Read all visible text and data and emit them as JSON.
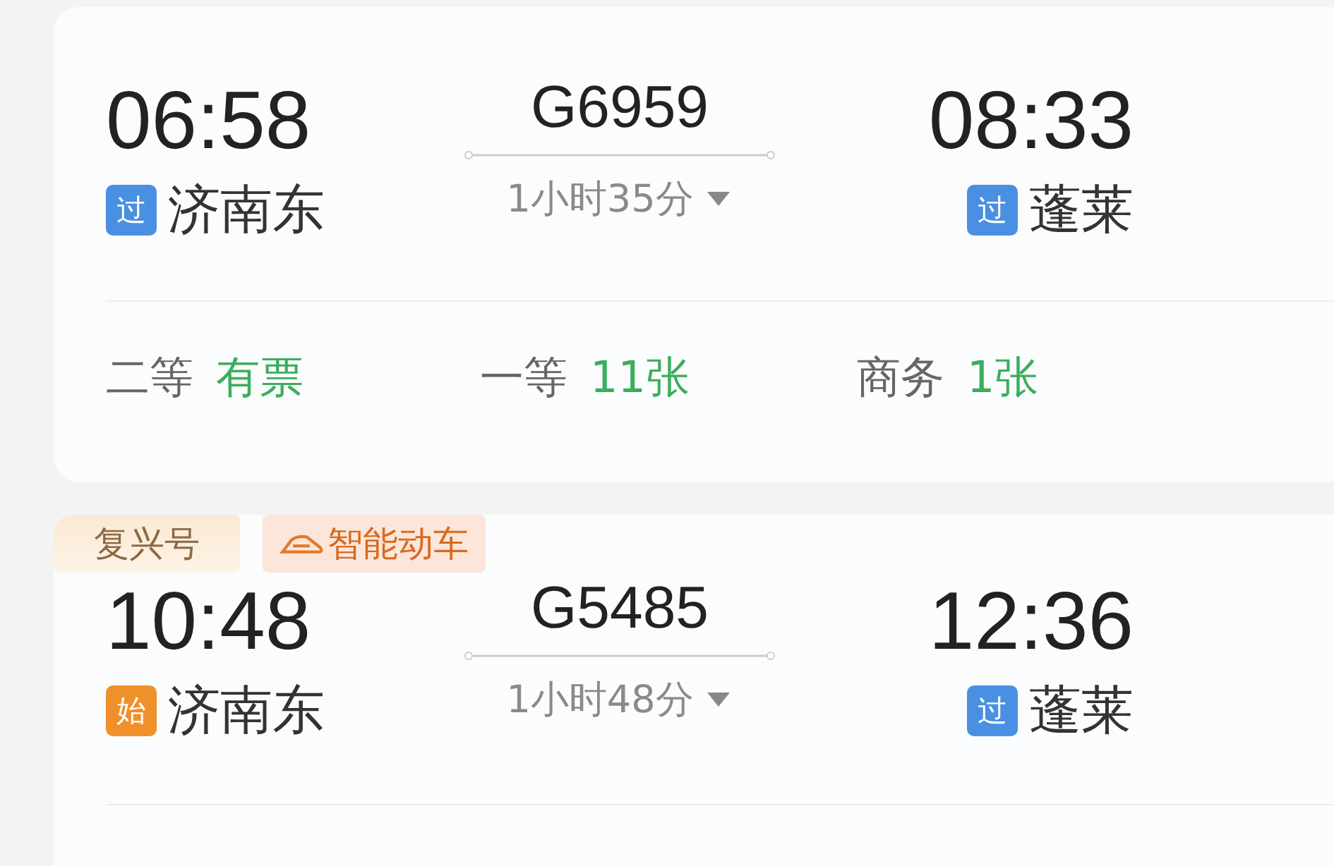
{
  "trains": [
    {
      "depart": {
        "time": "06:58",
        "station": "济南东",
        "badge": {
          "label": "过",
          "kind": "pass"
        }
      },
      "number": "G6959",
      "duration": "1小时35分",
      "arrive": {
        "time": "08:33",
        "station": "蓬莱",
        "badge": {
          "label": "过",
          "kind": "pass"
        }
      },
      "seats": [
        {
          "class": "二等",
          "availability": "有票"
        },
        {
          "class": "一等",
          "availability": "11张"
        },
        {
          "class": "商务",
          "availability": "1张"
        }
      ]
    },
    {
      "tags": [
        {
          "label": "复兴号",
          "kind": "fuxing"
        },
        {
          "label": "智能动车",
          "kind": "smart"
        }
      ],
      "depart": {
        "time": "10:48",
        "station": "济南东",
        "badge": {
          "label": "始",
          "kind": "origin"
        }
      },
      "number": "G5485",
      "duration": "1小时48分",
      "arrive": {
        "time": "12:36",
        "station": "蓬莱",
        "badge": {
          "label": "过",
          "kind": "pass"
        }
      }
    }
  ]
}
